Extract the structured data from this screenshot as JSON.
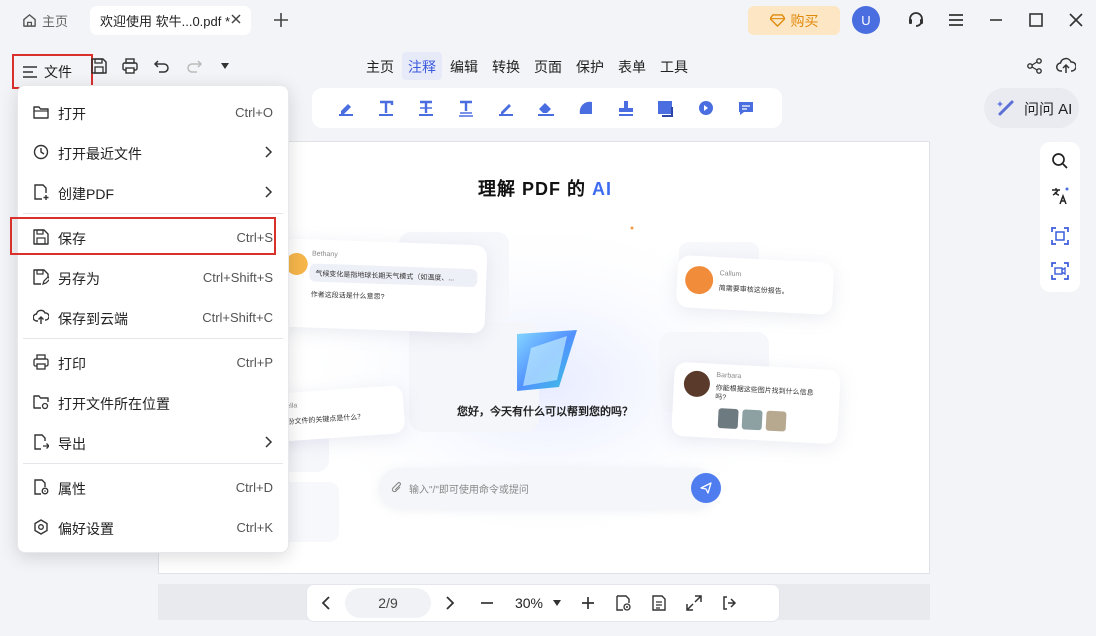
{
  "titlebar": {
    "home_tab": "主页",
    "doc_tab": "欢迎使用 软牛...0.pdf *",
    "buy_label": "购买",
    "avatar_letter": "U"
  },
  "toolbar": {
    "file_label": "文件",
    "tabs": [
      "主页",
      "注释",
      "编辑",
      "转换",
      "页面",
      "保护",
      "表单",
      "工具"
    ],
    "active_tab": "注释",
    "ai_label": "问问 AI"
  },
  "file_menu": {
    "items": [
      {
        "label": "打开",
        "shortcut": "Ctrl+O",
        "icon": "folder-open-icon"
      },
      {
        "label": "打开最近文件",
        "shortcut": "",
        "icon": "clock-icon",
        "submenu": true
      },
      {
        "label": "创建PDF",
        "shortcut": "",
        "icon": "create-file-icon",
        "submenu": true
      },
      {
        "label": "保存",
        "shortcut": "Ctrl+S",
        "icon": "save-icon"
      },
      {
        "label": "另存为",
        "shortcut": "Ctrl+Shift+S",
        "icon": "save-as-icon"
      },
      {
        "label": "保存到云端",
        "shortcut": "Ctrl+Shift+C",
        "icon": "cloud-upload-icon"
      },
      {
        "label": "打印",
        "shortcut": "Ctrl+P",
        "icon": "print-icon"
      },
      {
        "label": "打开文件所在位置",
        "shortcut": "",
        "icon": "file-location-icon"
      },
      {
        "label": "导出",
        "shortcut": "",
        "icon": "export-icon",
        "submenu": true
      },
      {
        "label": "属性",
        "shortcut": "Ctrl+D",
        "icon": "properties-icon"
      },
      {
        "label": "偏好设置",
        "shortcut": "Ctrl+K",
        "icon": "settings-icon"
      }
    ]
  },
  "page": {
    "title_prefix": "理解 PDF 的 ",
    "title_ai": "AI",
    "hello": "您好，今天有什么可以帮到您的吗？",
    "input_placeholder": "输入\"/\"即可使用命令或提问",
    "bubbles": {
      "bethany_name": "Bethany",
      "bethany_quote": "气候变化是指地球长期天气模式（如温度、...",
      "bethany_q": "作者这段话是什么意思?",
      "callum_name": "Callum",
      "callum_text": "简需要审核这份报告。",
      "barbara_name": "Barbara",
      "barbara_text": "你能根据这些图片找到什么信息吗?",
      "left_name": "ella",
      "left_text": "份文件的关键点是什么？"
    }
  },
  "bottom": {
    "page_indicator": "2/9",
    "zoom": "30%"
  },
  "colors": {
    "accent": "#3b5bdb",
    "highlight_border": "#d9302c",
    "buy_bg": "#fde6c4",
    "buy_text": "#e08a0b"
  }
}
